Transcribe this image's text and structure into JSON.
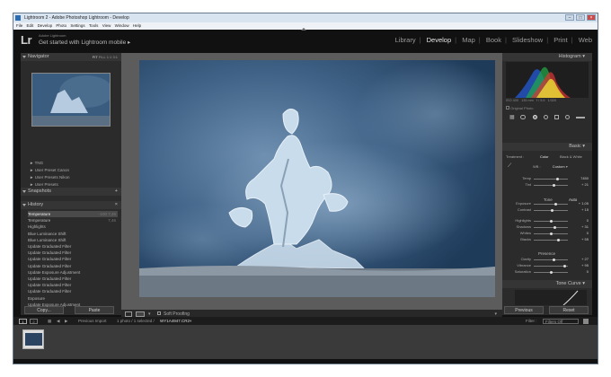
{
  "window": {
    "title": "Lightroom 2 - Adobe Photoshop Lightroom - Develop"
  },
  "menu": [
    "File",
    "Edit",
    "Develop",
    "Photo",
    "Settings",
    "Tools",
    "View",
    "Window",
    "Help"
  ],
  "identity": {
    "logo": "Lr",
    "sub": "Adobe Lightroom",
    "main": "Get started with Lightroom mobile"
  },
  "modules": [
    "Library",
    "Develop",
    "Map",
    "Book",
    "Slideshow",
    "Print",
    "Web"
  ],
  "active_module": "Develop",
  "navigator": {
    "label": "Navigator",
    "zoom": [
      "FIT",
      "FILL",
      "1:1",
      "3:1"
    ]
  },
  "presets": [
    "TNG",
    "User Preset Canon",
    "User Presets Nikon",
    "User Presets"
  ],
  "snapshots": {
    "label": "Snapshots",
    "add": "+"
  },
  "history": {
    "label": "History",
    "close": "×",
    "items": [
      {
        "name": "Temperature",
        "a": "-100",
        "b": "7,46"
      },
      {
        "name": "Temperature",
        "a": "",
        "b": "7,46"
      },
      {
        "name": "Highlights",
        "a": "",
        "b": ""
      },
      {
        "name": "Blue Luminance Shift",
        "a": "",
        "b": ""
      },
      {
        "name": "Blue Luminance Shift",
        "a": "",
        "b": ""
      },
      {
        "name": "Update Graduated Filter",
        "a": "",
        "b": ""
      },
      {
        "name": "Update Graduated Filter",
        "a": "",
        "b": ""
      },
      {
        "name": "Update Graduated Filter",
        "a": "",
        "b": ""
      },
      {
        "name": "Update Graduated Filter",
        "a": "",
        "b": ""
      },
      {
        "name": "Update Exposure Adjustment",
        "a": "",
        "b": ""
      },
      {
        "name": "Update Graduated Filter",
        "a": "",
        "b": ""
      },
      {
        "name": "Update Graduated Filter",
        "a": "",
        "b": ""
      },
      {
        "name": "Update Graduated Filter",
        "a": "",
        "b": ""
      },
      {
        "name": "Exposure",
        "a": "",
        "b": ""
      },
      {
        "name": "Update Exposure Adjustment",
        "a": "",
        "b": ""
      }
    ]
  },
  "left_buttons": {
    "copy": "Copy...",
    "paste": "Paste"
  },
  "toolbar": {
    "soft_proofing": "Soft Proofing"
  },
  "histogram": {
    "label": "Histogram",
    "info": [
      "ISO 400",
      "135 mm",
      "f / 5.6",
      "1/320"
    ],
    "original": "Original Photo"
  },
  "basic": {
    "label": "Basic",
    "treatment": "Treatment :",
    "color": "Color",
    "bw": "Black & White",
    "wb_label": "WB :",
    "wb_value": "Custom",
    "tone": "Tone",
    "auto": "Auto",
    "presence": "Presence",
    "sliders": [
      {
        "name": "Temp",
        "value": "7450",
        "pos": 0.7
      },
      {
        "name": "Tint",
        "value": "+ 21",
        "pos": 0.6
      },
      {
        "name": "Exposure",
        "value": "+ 1,05",
        "pos": 0.65
      },
      {
        "name": "Contrast",
        "value": "+ 15",
        "pos": 0.55
      },
      {
        "name": "Highlights",
        "value": "0",
        "pos": 0.5
      },
      {
        "name": "Shadows",
        "value": "+ 31",
        "pos": 0.62
      },
      {
        "name": "Whites",
        "value": "0",
        "pos": 0.5
      },
      {
        "name": "Blacks",
        "value": "+ 55",
        "pos": 0.72
      },
      {
        "name": "Clarity",
        "value": "+ 27",
        "pos": 0.6
      },
      {
        "name": "Vibrance",
        "value": "+ 95",
        "pos": 0.9
      },
      {
        "name": "Saturation",
        "value": "0",
        "pos": 0.5
      }
    ]
  },
  "tone_curve": {
    "label": "Tone Curve"
  },
  "right_buttons": {
    "previous": "Previous",
    "reset": "Reset"
  },
  "filmstrip": {
    "pages": [
      "1",
      "2"
    ],
    "source": "Previous Import",
    "count": "1 photo / 1 selected /",
    "file": "WY1A4947.CR2",
    "filter_label": "Filter :",
    "filter_value": "Filters Off"
  },
  "colors": {
    "accent": "#e6e6e6",
    "panel": "#2b2b2b",
    "photo": "#35577a"
  }
}
